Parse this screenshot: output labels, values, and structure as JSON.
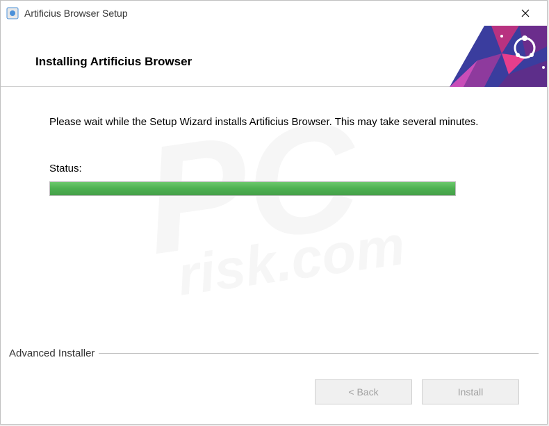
{
  "titlebar": {
    "title": "Artificius Browser Setup"
  },
  "header": {
    "title": "Installing Artificius Browser"
  },
  "content": {
    "instruction": "Please wait while the Setup Wizard installs Artificius Browser.  This may take several minutes.",
    "status_label": "Status:",
    "progress_percent": 100
  },
  "footer": {
    "brand": "Advanced Installer",
    "back_label": "< Back",
    "install_label": "Install"
  },
  "watermark": {
    "line1": "PC",
    "line2": "risk.com"
  }
}
